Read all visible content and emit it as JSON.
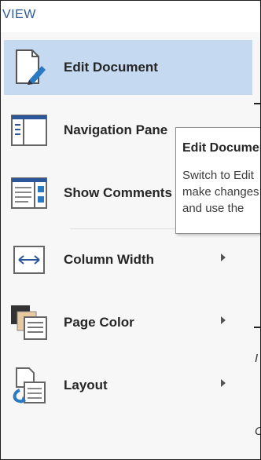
{
  "ribbon": {
    "tab_label": "VIEW"
  },
  "menu": {
    "items": [
      {
        "name": "edit-document",
        "label": "Edit Document",
        "selected": true,
        "has_submenu": false,
        "icon": "edit-document-icon"
      },
      {
        "name": "navigation-pane",
        "label": "Navigation Pane",
        "selected": false,
        "has_submenu": false,
        "icon": "navigation-pane-icon"
      },
      {
        "name": "show-comments",
        "label": "Show Comments",
        "selected": false,
        "has_submenu": false,
        "icon": "show-comments-icon"
      },
      {
        "name": "column-width",
        "label": "Column Width",
        "selected": false,
        "has_submenu": true,
        "icon": "column-width-icon"
      },
      {
        "name": "page-color",
        "label": "Page Color",
        "selected": false,
        "has_submenu": true,
        "icon": "page-color-icon"
      },
      {
        "name": "layout",
        "label": "Layout",
        "selected": false,
        "has_submenu": true,
        "icon": "layout-icon"
      }
    ]
  },
  "tooltip": {
    "title": "Edit Document",
    "lines": [
      "Switch to Edit",
      "make changes",
      "and use the"
    ]
  },
  "right_edge": {
    "letter_1": "I",
    "letter_2": "C"
  },
  "colors": {
    "selected_bg": "#c5d9f1",
    "accent_blue": "#2b579a",
    "menu_bg": "#f7f7f7"
  }
}
